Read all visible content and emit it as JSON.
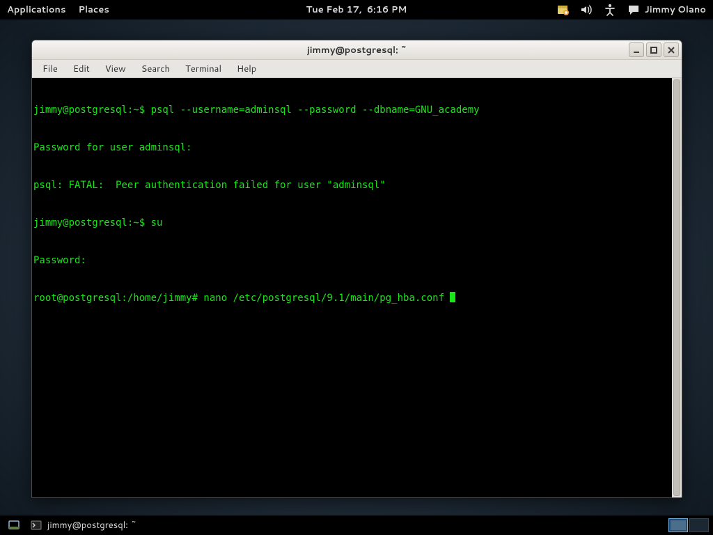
{
  "top_panel": {
    "menus": {
      "applications": "Applications",
      "places": "Places"
    },
    "clock": "Tue Feb 17,  6:16 PM",
    "user_name": "Jimmy Olano",
    "icons": {
      "update": "update-notifier-icon",
      "volume": "volume-icon",
      "accessibility": "accessibility-icon",
      "chat": "chat-status-icon"
    }
  },
  "window": {
    "title": "jimmy@postgresql: ~",
    "menubar": {
      "file": "File",
      "edit": "Edit",
      "view": "View",
      "search": "Search",
      "terminal": "Terminal",
      "help": "Help"
    },
    "controls": {
      "minimize": "minimize",
      "maximize": "maximize",
      "close": "close"
    }
  },
  "terminal": {
    "lines": [
      "jimmy@postgresql:~$ psql --username=adminsql --password --dbname=GNU_academy",
      "Password for user adminsql: ",
      "psql: FATAL:  Peer authentication failed for user \"adminsql\"",
      "jimmy@postgresql:~$ su",
      "Password: ",
      "root@postgresql:/home/jimmy# nano /etc/postgresql/9.1/main/pg_hba.conf "
    ],
    "colors": {
      "fg": "#19e619",
      "bg": "#000000"
    }
  },
  "bottom_panel": {
    "task_label": "jimmy@postgresql: ~",
    "workspaces": {
      "count": 2,
      "active": 0
    }
  }
}
